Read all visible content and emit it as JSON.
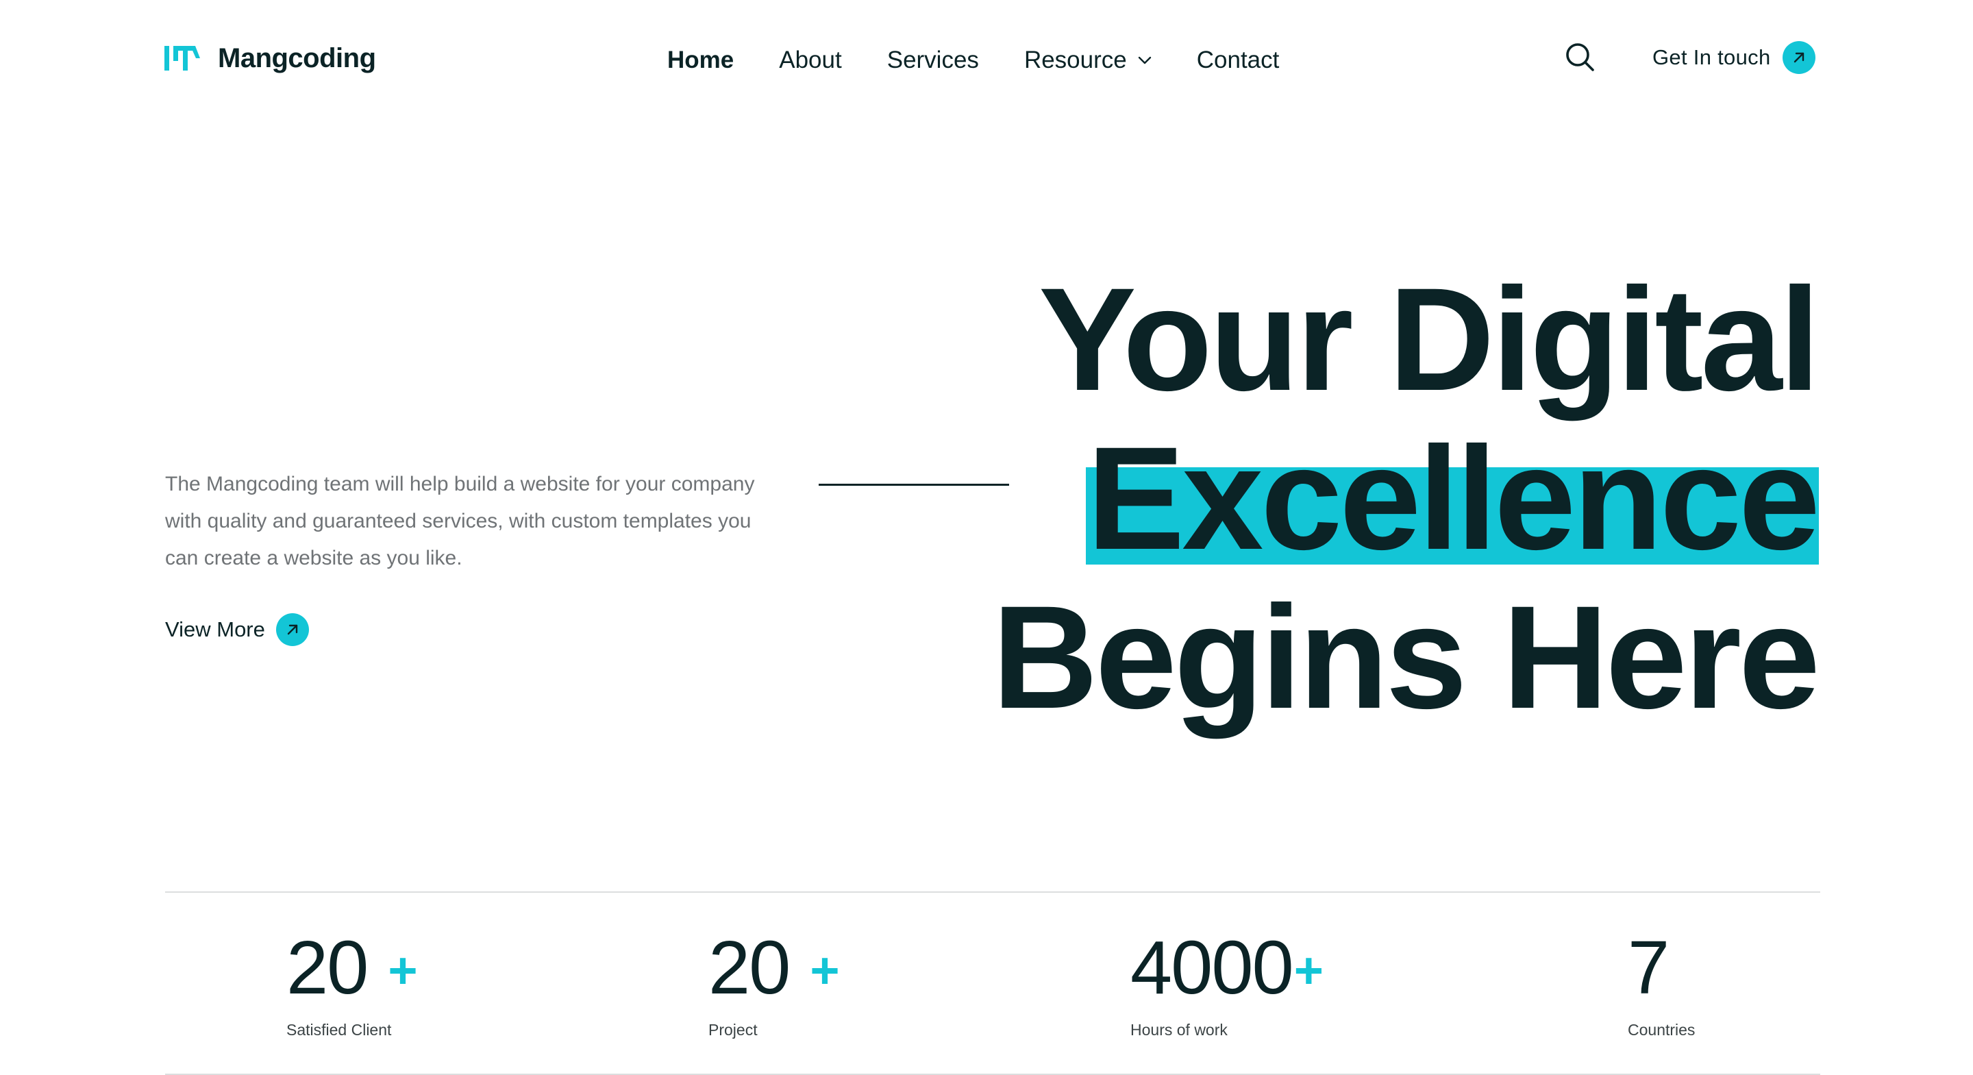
{
  "brand": {
    "name": "Mangcoding",
    "accent_color": "#13c5d6",
    "text_color": "#0b2326"
  },
  "nav": {
    "items": [
      {
        "label": "Home",
        "active": true
      },
      {
        "label": "About"
      },
      {
        "label": "Services"
      },
      {
        "label": "Resource",
        "icon": "chevron-down-icon"
      },
      {
        "label": "Contact"
      }
    ]
  },
  "header": {
    "search_icon": "search-icon",
    "cta_label": "Get In touch",
    "cta_icon": "arrow-up-right-icon"
  },
  "hero": {
    "description": "The Mangcoding team will help build a website for your company with quality and guaranteed services, with custom templates you can create a website as you like.",
    "view_more_label": "View More",
    "headline_line1": "Your Digital",
    "headline_line2": "Excellence",
    "headline_line3": "Begins Here"
  },
  "stats": [
    {
      "value": "20",
      "suffix": "+",
      "label": "Satisfied Client"
    },
    {
      "value": "20",
      "suffix": "+",
      "label": "Project"
    },
    {
      "value": "4000",
      "suffix": "+",
      "label": "Hours of work"
    },
    {
      "value": "7",
      "suffix": "",
      "label": "Countries"
    }
  ]
}
